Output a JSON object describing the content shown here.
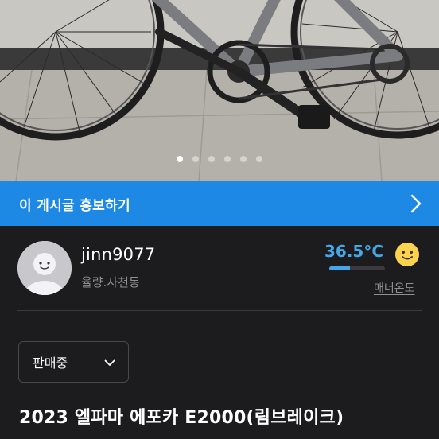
{
  "photo": {
    "description_icon": "bicycle-photo",
    "page_count": 6,
    "active_page": 1
  },
  "promo": {
    "label": "이 게시글 홍보하기",
    "icon": "chevron-right-icon",
    "color": "#1e88e5"
  },
  "seller": {
    "username": "jinn9077",
    "location": "율량.사천동",
    "avatar_icon": "default-avatar-icon",
    "temperature": "36.5°C",
    "temperature_level": 0.365,
    "temperature_color": "#46a7e8",
    "manner_label": "매너온도",
    "mood_icon": "smiley-face-icon"
  },
  "listing": {
    "status": "판매중",
    "status_icon": "chevron-down-icon",
    "title": "2023 엘파마 에포카 E2000(림브레이크)"
  }
}
